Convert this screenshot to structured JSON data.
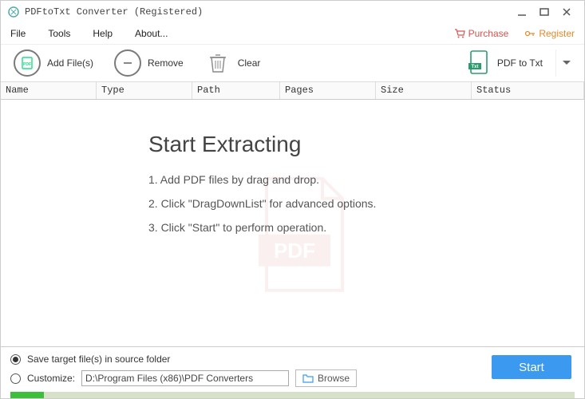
{
  "window": {
    "title": "PDFtoTxt Converter (Registered)"
  },
  "menu": {
    "file": "File",
    "tools": "Tools",
    "help": "Help",
    "about": "About...",
    "purchase": "Purchase",
    "register": "Register"
  },
  "toolbar": {
    "add": "Add File(s)",
    "remove": "Remove",
    "clear": "Clear",
    "convert": "PDF to Txt"
  },
  "columns": {
    "name": "Name",
    "type": "Type",
    "path": "Path",
    "pages": "Pages",
    "size": "Size",
    "status": "Status"
  },
  "instructions": {
    "heading": "Start Extracting",
    "step1": "1. Add PDF files by drag and drop.",
    "step2": "2. Click \"DragDownList\" for advanced options.",
    "step3": "3. Click \"Start\" to perform operation."
  },
  "options": {
    "save_source": "Save target file(s) in source folder",
    "customize": "Customize:",
    "path": "D:\\Program Files (x86)\\PDF Converters",
    "browse": "Browse"
  },
  "start_label": "Start"
}
